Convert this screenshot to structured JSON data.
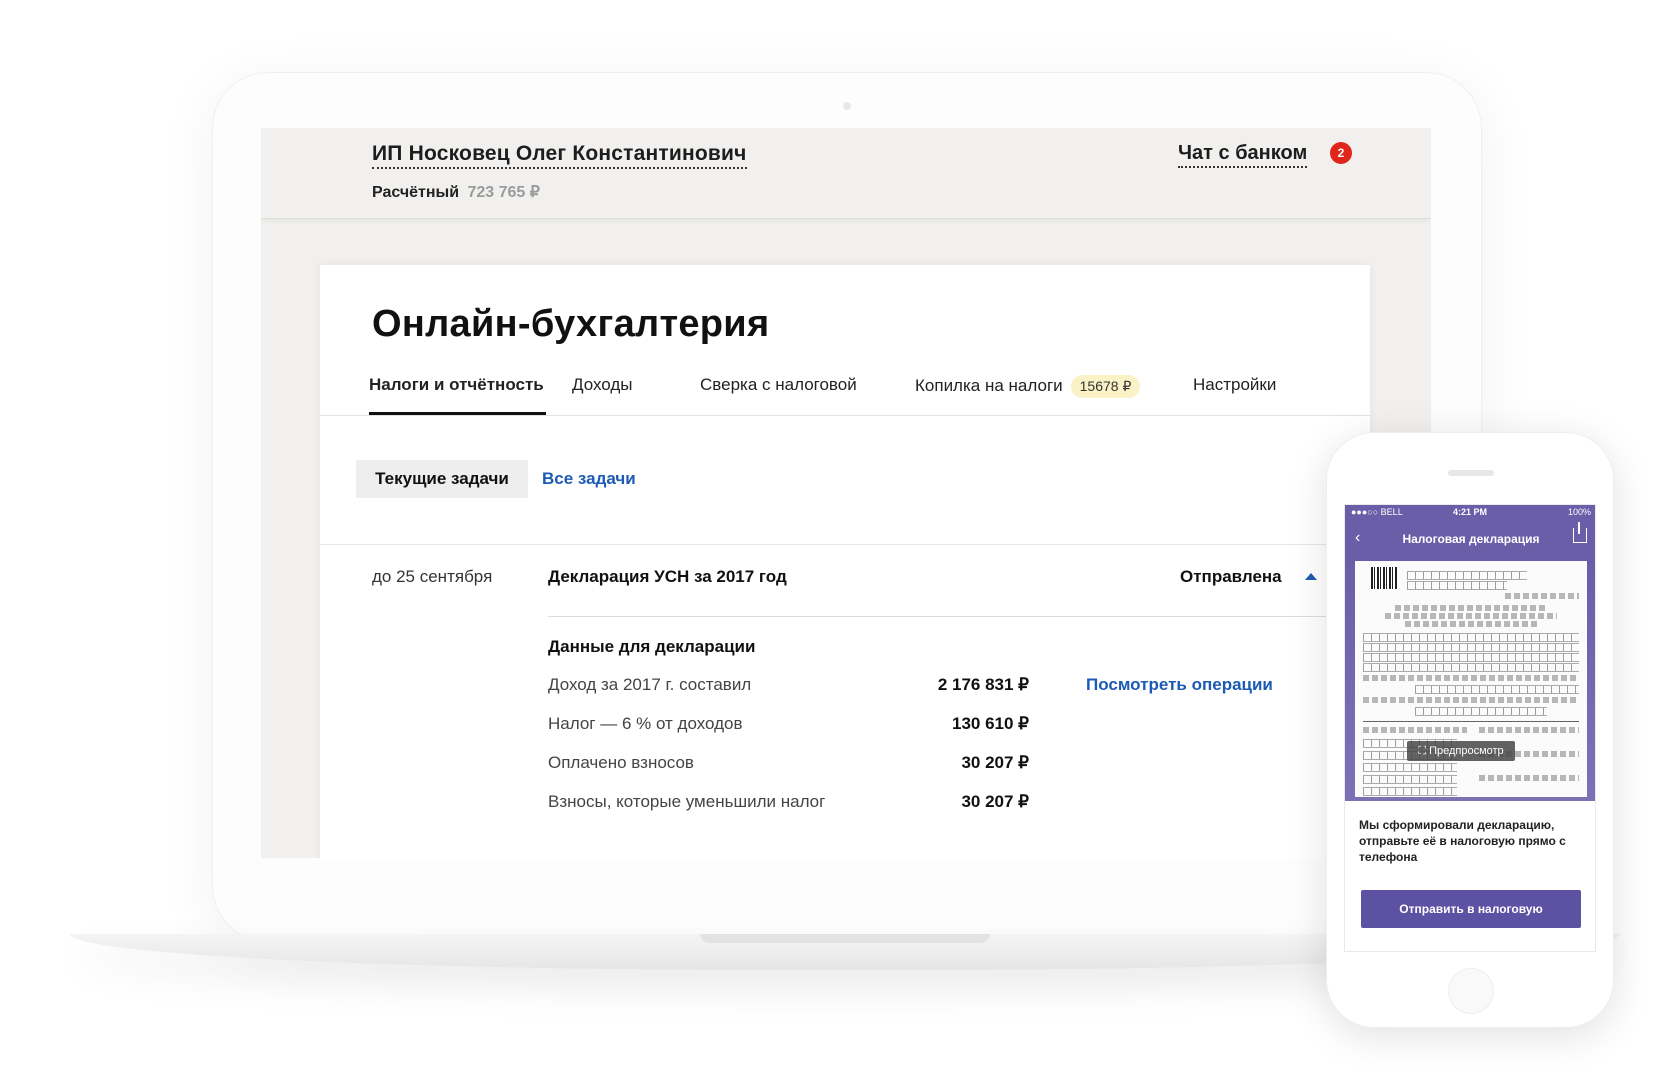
{
  "header": {
    "org_name": "ИП  Носковец Олег Константинович",
    "account_label": "Расчётный",
    "account_amount": "723 765 ₽",
    "chat_label": "Чат с банком",
    "chat_badge": "2"
  },
  "main": {
    "title": "Онлайн-бухгалтерия",
    "tabs": [
      {
        "label": "Налоги и отчётность",
        "active": true
      },
      {
        "label": "Доходы"
      },
      {
        "label": "Сверка с налоговой"
      },
      {
        "label": "Копилка на налоги",
        "badge": "15678 ₽"
      },
      {
        "label": "Настройки"
      }
    ],
    "filters": {
      "current": "Текущие задачи",
      "all": "Все задачи"
    },
    "task": {
      "deadline": "до 25 сентября",
      "title": "Декларация УСН за 2017 год",
      "status": "Отправлена",
      "section_title": "Данные для декларации",
      "rows": [
        {
          "label": "Доход за 2017 г. составил",
          "value": "2 176 831 ₽",
          "link": "Посмотреть операции"
        },
        {
          "label": "Налог — 6 % от доходов",
          "value": "130 610 ₽"
        },
        {
          "label": "Оплачено взносов",
          "value": "30 207 ₽"
        },
        {
          "label": "Взносы, которые уменьшили налог",
          "value": "30 207 ₽"
        }
      ]
    }
  },
  "phone": {
    "carrier": "●●●○○ BELL",
    "time": "4:21 PM",
    "battery": "100%",
    "nav_title": "Налоговая декларация",
    "back_icon": "chevron-left-icon",
    "share_icon": "share-icon",
    "preview_label": "⛶ Предпросмотр",
    "message": "Мы сформировали  декларацию, отправьте её в налоговую прямо с телефона",
    "button": "Отправить в налоговую"
  },
  "colors": {
    "accent": "#1c5bb3",
    "brand": "#6a5ea9",
    "button": "#5d51a3",
    "badge": "#e0261b"
  }
}
